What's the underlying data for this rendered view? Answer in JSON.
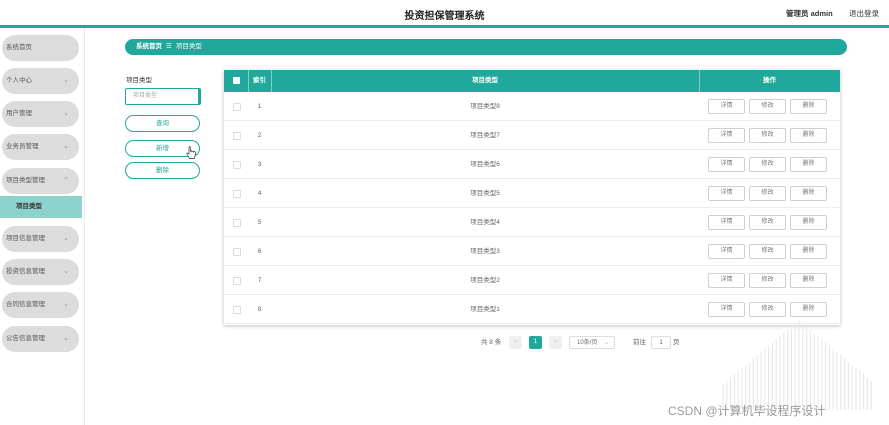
{
  "header": {
    "title": "投资担保管理系统",
    "user": "管理员 admin",
    "logout": "退出登录"
  },
  "sidebar": {
    "items": [
      {
        "label": "系统首页",
        "chevron": false
      },
      {
        "label": "个人中心",
        "chevron": true
      },
      {
        "label": "用户管理",
        "chevron": true
      },
      {
        "label": "业务员管理",
        "chevron": true
      },
      {
        "label": "项目类型管理",
        "chevron": true,
        "expanded": true
      },
      {
        "label": "项目信息管理",
        "chevron": true
      },
      {
        "label": "投资信息管理",
        "chevron": true
      },
      {
        "label": "合同信息管理",
        "chevron": true
      },
      {
        "label": "公告信息管理",
        "chevron": true
      }
    ],
    "sub_item": "项目类型"
  },
  "breadcrumb": {
    "home": "系统首页",
    "separator": "☰",
    "current": "项目类型"
  },
  "search": {
    "label": "项目类型",
    "placeholder": "项目类型",
    "query_button": "查询",
    "add_button": "新增",
    "delete_button": "删除"
  },
  "table": {
    "headers": {
      "index": "索引",
      "type": "项目类型",
      "actions": "操作"
    },
    "rows": [
      {
        "index": "1",
        "type": "项目类型8"
      },
      {
        "index": "2",
        "type": "项目类型7"
      },
      {
        "index": "3",
        "type": "项目类型6"
      },
      {
        "index": "4",
        "type": "项目类型5"
      },
      {
        "index": "5",
        "type": "项目类型4"
      },
      {
        "index": "6",
        "type": "项目类型3"
      },
      {
        "index": "7",
        "type": "项目类型2"
      },
      {
        "index": "8",
        "type": "项目类型1"
      }
    ],
    "row_actions": {
      "detail": "详情",
      "edit": "修改",
      "delete": "删除"
    }
  },
  "pagination": {
    "total": "共 8 条",
    "prev": "‹",
    "current_page": "1",
    "next": "›",
    "page_size": "10条/页",
    "goto_label": "前往",
    "goto_value": "1",
    "page_unit": "页"
  },
  "watermark": "CSDN @计算机毕设程序设计",
  "colors": {
    "accent": "#1fa89b",
    "menu_bg": "#dcdcdc",
    "submenu_bg": "#8ed2ce"
  }
}
